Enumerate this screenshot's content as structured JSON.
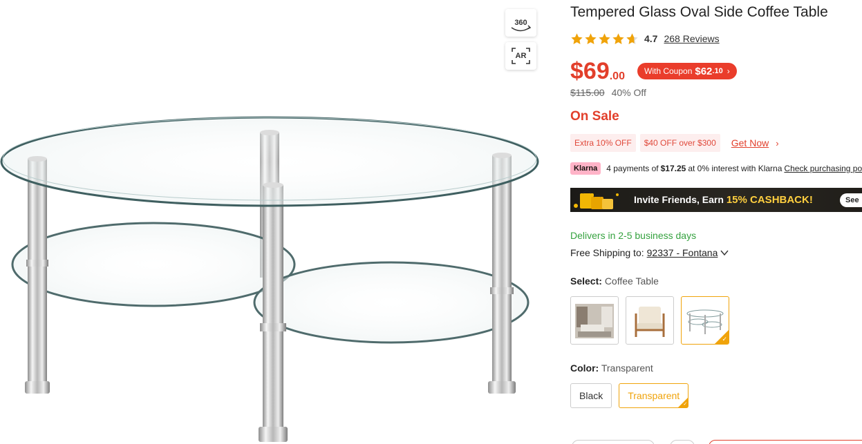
{
  "gallery": {
    "view_360_label": "360",
    "view_ar_label": "AR"
  },
  "product": {
    "title": "Tempered Glass Oval Side Coffee Table",
    "rating": "4.7",
    "rating_value": 4.7,
    "reviews_label": "268 Reviews"
  },
  "price": {
    "main": "$69",
    "cents": ".00",
    "coupon_prefix": "With Coupon",
    "coupon_price_main": "$62",
    "coupon_price_cents": ".10",
    "original": "$115.00",
    "discount": "40% Off",
    "sale_label": "On Sale"
  },
  "promos": {
    "tag1": "Extra 10% OFF",
    "tag2": "$40 OFF over $300",
    "get_now": "Get Now"
  },
  "klarna": {
    "badge": "Klarna",
    "text_before": "4 payments of",
    "amount": "$17.25",
    "text_after": "at 0% interest with Klarna",
    "link": "Check purchasing power"
  },
  "invite": {
    "text": "Invite Friends, Earn",
    "highlight": "15% CASHBACK!",
    "button": "See"
  },
  "shipping": {
    "delivery": "Delivers in 2-5 business days",
    "ship_prefix": "Free Shipping to:",
    "location": "92337 - Fontana"
  },
  "select": {
    "label": "Select:",
    "value": "Coffee Table",
    "selected_index": 2
  },
  "color": {
    "label": "Color:",
    "value": "Transparent",
    "options": [
      "Black",
      "Transparent"
    ]
  },
  "colors": {
    "accent_red": "#e23f2b",
    "accent_orange": "#f0a30a",
    "delivery_green": "#35a23f",
    "klarna_pink": "#ffb3c7"
  },
  "icons": [
    "360-view-icon",
    "ar-icon",
    "star-icon",
    "chevron-right-icon",
    "chevron-down-icon",
    "check-icon"
  ]
}
